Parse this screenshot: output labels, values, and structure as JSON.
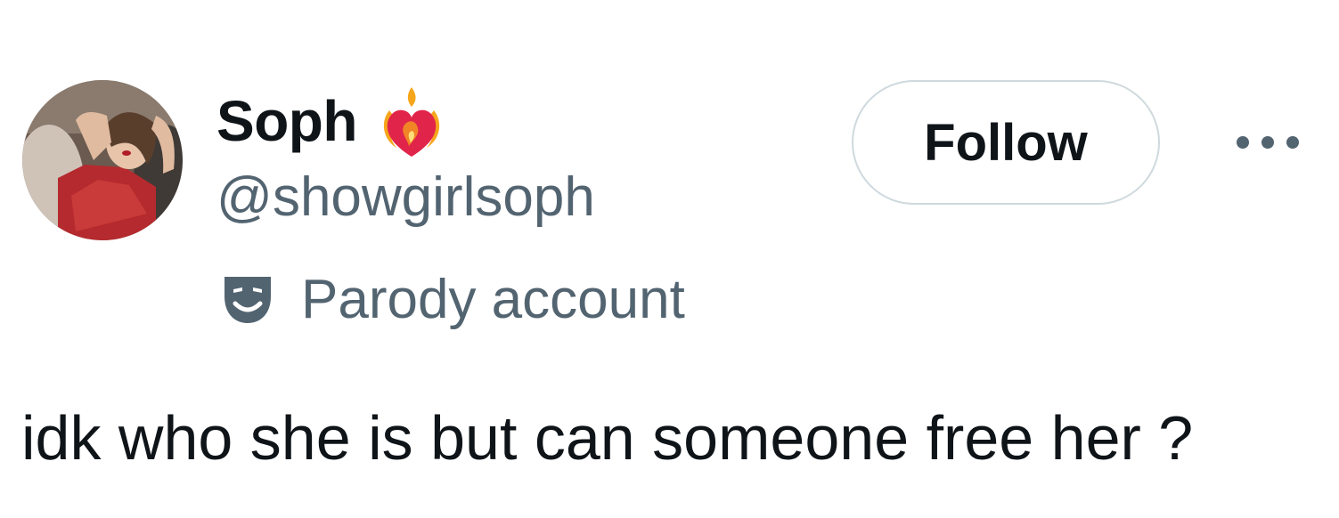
{
  "author": {
    "display_name": "Soph",
    "name_badge_icon": "heart-on-fire-icon",
    "handle": "@showgirlsoph",
    "label_icon": "parody-mask-icon",
    "label": "Parody account"
  },
  "actions": {
    "follow_label": "Follow",
    "more_icon": "more-options-icon"
  },
  "tweet": {
    "text": "idk who she is but can someone free her ?"
  },
  "colors": {
    "primary_text": "#0f1419",
    "secondary_text": "#536471",
    "follow_border": "#cfd9de",
    "badge_red": "#e1254a",
    "badge_flame": "#f6a61b"
  }
}
